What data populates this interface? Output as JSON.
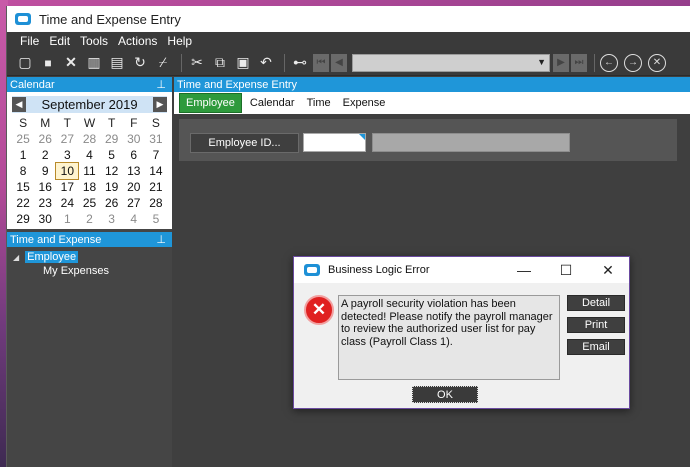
{
  "window": {
    "title": "Time and Expense Entry"
  },
  "menu": [
    "File",
    "Edit",
    "Tools",
    "Actions",
    "Help"
  ],
  "toolbar": {
    "icons": [
      "new-icon",
      "save-icon",
      "delete-icon",
      "book-icon",
      "clipboard-icon",
      "refresh-icon",
      "broom-icon",
      "cut-icon",
      "copy-icon",
      "paste-icon",
      "undo-icon",
      "binoculars-icon",
      "first-icon",
      "prev-icon",
      "next-icon",
      "last-icon",
      "back-icon",
      "forward-icon",
      "close-record-icon"
    ],
    "combo_value": ""
  },
  "calendar_pane": {
    "title": "Calendar",
    "pin": "⊥",
    "month": "September 2019",
    "dow": [
      "S",
      "M",
      "T",
      "W",
      "T",
      "F",
      "S"
    ],
    "weeks": [
      [
        "25",
        "26",
        "27",
        "28",
        "29",
        "30",
        "31"
      ],
      [
        "1",
        "2",
        "3",
        "4",
        "5",
        "6",
        "7"
      ],
      [
        "8",
        "9",
        "10",
        "11",
        "12",
        "13",
        "14"
      ],
      [
        "15",
        "16",
        "17",
        "18",
        "19",
        "20",
        "21"
      ],
      [
        "22",
        "23",
        "24",
        "25",
        "26",
        "27",
        "28"
      ],
      [
        "29",
        "30",
        "1",
        "2",
        "3",
        "4",
        "5"
      ]
    ],
    "today": "10"
  },
  "te_pane": {
    "title": "Time and Expense",
    "pin": "⊥",
    "tree": {
      "root": "Employee",
      "child": "My Expenses"
    }
  },
  "main": {
    "header": "Time and Expense Entry",
    "tabs": [
      "Employee",
      "Calendar",
      "Time",
      "Expense"
    ],
    "employee_id_label": "Employee ID...",
    "employee_id_value": "",
    "employee_name_value": ""
  },
  "dialog": {
    "title": "Business Logic Error",
    "message": "A payroll security violation has been detected! Please notify the payroll manager to review the authorized user list for pay class (Payroll Class 1).",
    "buttons": {
      "detail": "Detail",
      "print": "Print",
      "email": "Email",
      "ok": "OK"
    }
  }
}
